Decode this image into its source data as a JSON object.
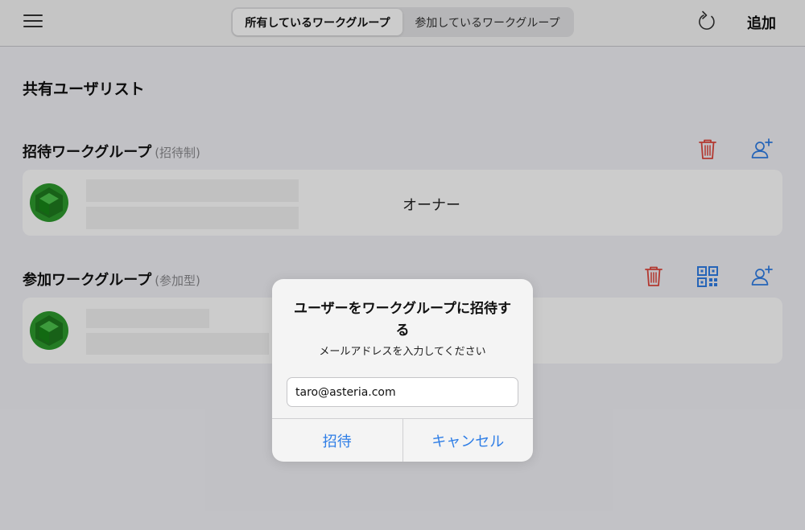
{
  "header": {
    "segments": [
      {
        "label": "所有しているワークグループ",
        "active": true
      },
      {
        "label": "参加しているワークグループ",
        "active": false
      }
    ],
    "add_label": "追加"
  },
  "page": {
    "title": "共有ユーザリスト"
  },
  "sections": [
    {
      "title": "招待ワークグループ",
      "type": "(招待制)",
      "members": [
        {
          "role": "オーナー"
        }
      ]
    },
    {
      "title": "参加ワークグループ",
      "type": "(参加型)",
      "members": [
        {
          "role": ""
        }
      ]
    }
  ],
  "dialog": {
    "title": "ユーザーをワークグループに招待する",
    "message": "メールアドレスを入力してください",
    "input_value": "taro@asteria.com",
    "invite_label": "招待",
    "cancel_label": "キャンセル"
  },
  "colors": {
    "accent": "#2f7ee6",
    "danger": "#e0473d",
    "avatar_green": "#2e9a2e"
  }
}
